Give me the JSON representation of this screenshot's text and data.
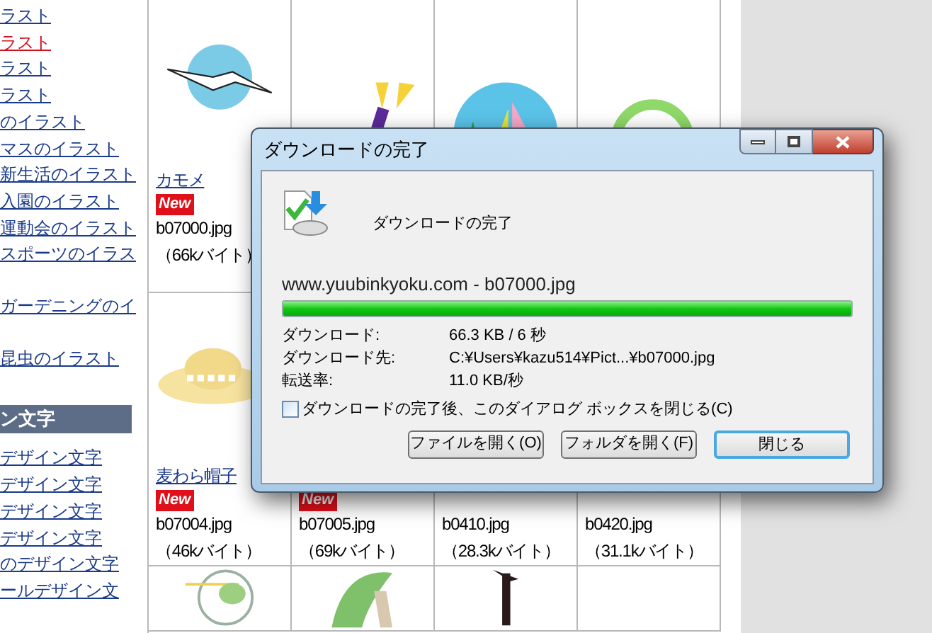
{
  "sidebar": {
    "links": [
      {
        "label": "ラスト",
        "selected": false
      },
      {
        "label": "ラスト",
        "selected": true
      },
      {
        "label": "ラスト",
        "selected": false
      },
      {
        "label": "ラスト",
        "selected": false
      },
      {
        "label": "のイラスト",
        "selected": false
      },
      {
        "label": "マスのイラスト",
        "selected": false
      },
      {
        "label": "新生活のイラスト",
        "selected": false
      },
      {
        "label": "入園のイラスト",
        "selected": false
      },
      {
        "label": "運動会のイラスト",
        "selected": false
      },
      {
        "label": "スポーツのイラス",
        "selected": false
      },
      {
        "label": "ガーデニングのイ",
        "selected": false
      },
      {
        "label": "昆虫のイラスト",
        "selected": false
      }
    ],
    "section": {
      "title": "ン文字",
      "links": [
        {
          "label": "デザイン文字",
          "selected": false
        },
        {
          "label": "デザイン文字",
          "selected": false
        },
        {
          "label": "デザイン文字",
          "selected": false
        },
        {
          "label": "デザイン文字",
          "selected": false
        },
        {
          "label": "のデザイン文字",
          "selected": false
        },
        {
          "label": "ールデザイン文",
          "selected": false
        }
      ]
    }
  },
  "grid": {
    "rows": [
      [
        {
          "name": "カモメ",
          "badge": "New",
          "file": "b07000.jpg",
          "size": "（66kバイト）"
        },
        {},
        {},
        {}
      ],
      [
        {
          "name": "麦わら帽子",
          "badge": "New",
          "file": "b07004.jpg",
          "size": "（46kバイト）"
        },
        {
          "badge": "New",
          "file": "b07005.jpg",
          "size": "（69kバイト）"
        },
        {
          "file": "b0410.jpg",
          "size": "（28.3kバイト）"
        },
        {
          "file": "b0420.jpg",
          "size": "（31.1kバイト）"
        }
      ],
      [
        {},
        {},
        {},
        {}
      ]
    ]
  },
  "dialog": {
    "title": "ダウンロードの完了",
    "heading": "ダウンロードの完了",
    "source": "www.yuubinkyoku.com - b07000.jpg",
    "progress": {
      "level": 1
    },
    "details": [
      {
        "label": "ダウンロード:",
        "value": "66.3 KB / 6 秒"
      },
      {
        "label": "ダウンロード先:",
        "value": "C:¥Users¥kazu514¥Pict...¥b07000.jpg"
      },
      {
        "label": "転送率:",
        "value": "11.0 KB/秒"
      }
    ],
    "close_when_done": {
      "label": "ダウンロードの完了後、このダイアログ ボックスを閉じる(C)",
      "checked": false
    },
    "buttons": [
      {
        "label": "ファイルを開く(O)",
        "default": false
      },
      {
        "label": "フォルダを開く(F)",
        "default": false
      },
      {
        "label": "閉じる",
        "default": true
      }
    ]
  }
}
